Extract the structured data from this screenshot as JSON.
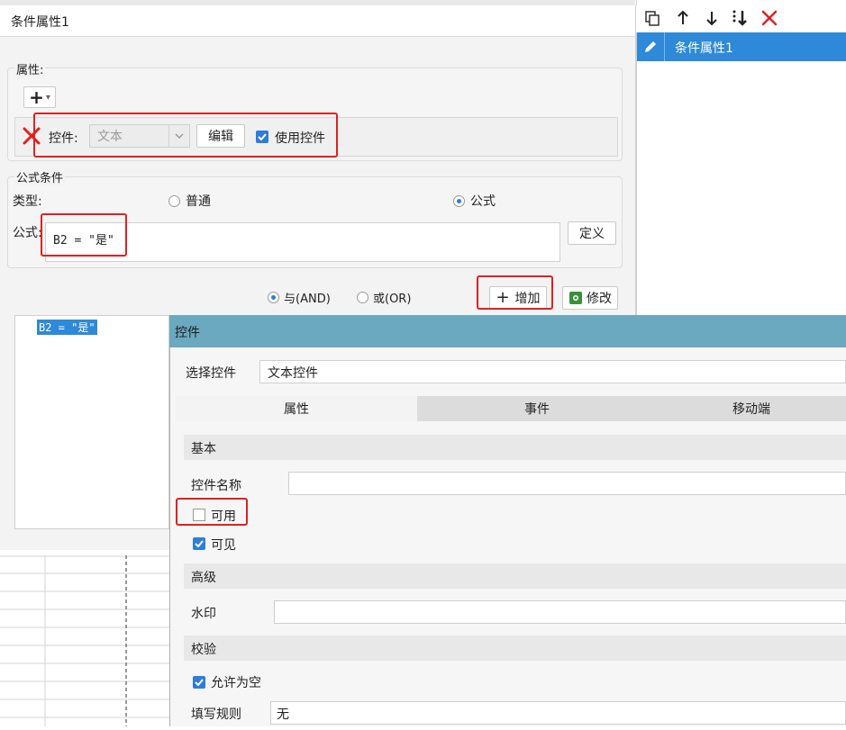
{
  "main_dialog": {
    "title": "条件属性1",
    "attr_section": {
      "legend": "属性:",
      "add_label": "+",
      "dropdown_arrow": "▾",
      "row": {
        "control_label": "控件:",
        "control_value": "文本",
        "edit_label": "编辑",
        "use_control_label": "使用控件",
        "use_control_checked": true
      }
    },
    "formula_section": {
      "legend": "公式条件",
      "type_label": "类型:",
      "option_normal": "普通",
      "option_formula": "公式",
      "formula_label": "公式:",
      "formula_value": "B2 = \"是\"",
      "define_label": "定义",
      "and_label": "与(AND)",
      "or_label": "或(OR)",
      "add_label": "增加",
      "modify_label": "修改",
      "condition_list": [
        "B2 = \"是\""
      ]
    }
  },
  "right_panel": {
    "items": [
      "条件属性1"
    ]
  },
  "control_dialog": {
    "title": "控件",
    "select_label": "选择控件",
    "select_value": "文本控件",
    "tabs": [
      "属性",
      "事件",
      "移动端"
    ],
    "basic": {
      "header": "基本",
      "name_label": "控件名称",
      "name_value": "",
      "enabled_label": "可用",
      "enabled_checked": false,
      "visible_label": "可见",
      "visible_checked": true
    },
    "advanced": {
      "header": "高级",
      "watermark_label": "水印",
      "watermark_value": ""
    },
    "validation": {
      "header": "校验",
      "allow_empty_label": "允许为空",
      "allow_empty_checked": true,
      "rule_label": "填写规则",
      "rule_value": "无"
    }
  },
  "colors": {
    "accent": "#2e7ddb",
    "selected_item": "#2e89d8",
    "dialog_title": "#6ba9c0",
    "highlight_red": "#e02020"
  }
}
